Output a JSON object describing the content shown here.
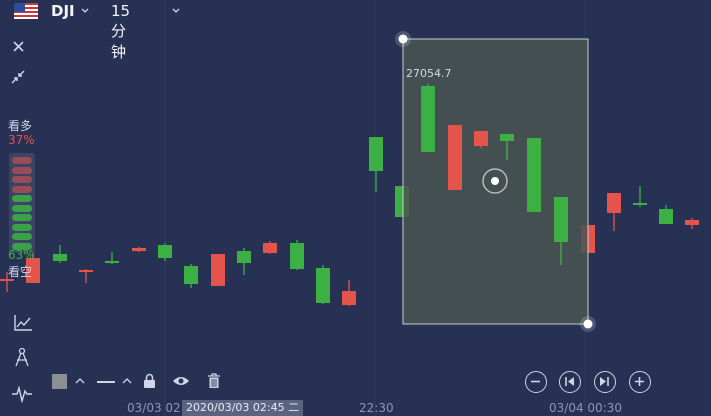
{
  "header": {
    "symbol": "DJI",
    "period": "15分钟"
  },
  "sentiment": {
    "bull_label": "看多",
    "bull_pct": "37%",
    "bear_pct": "63%",
    "bear_label": "看空",
    "bull_fraction": 0.37,
    "bull_color": "#e5544a",
    "bear_color": "#3cb043"
  },
  "selection": {
    "value_label": "27054.7"
  },
  "xaxis": {
    "tick1": "03/03 02",
    "tick2": "22:30",
    "tick3": "03/04 00:30",
    "cursor_label": "2020/03/03 02:45 二"
  },
  "colors": {
    "background": "#263154",
    "up": "#3cb043",
    "down": "#e5544a",
    "selection_fill": "#4a5551"
  },
  "icons": {
    "flag": "us-flag-icon",
    "close": "close-icon",
    "collapse": "collapse-icon",
    "indicator": "indicator-icon",
    "draw": "compass-icon",
    "wave": "waveform-icon",
    "lock": "lock-icon",
    "eye": "eye-icon",
    "trash": "trash-icon"
  },
  "chart_data": {
    "type": "candlestick",
    "candles": [
      {
        "t": 0,
        "o": 0.47,
        "h": 0.455,
        "l": 0.48,
        "c": 0.47,
        "dir": "down"
      },
      {
        "t": 1,
        "o": 0.44,
        "h": 0.425,
        "l": 0.448,
        "c": 0.44,
        "dir": "down"
      },
      {
        "t": 2,
        "o": 0.432,
        "h": 0.418,
        "l": 0.445,
        "c": 0.448,
        "dir": "up"
      },
      {
        "t": 3,
        "o": 0.475,
        "h": 0.47,
        "l": 0.495,
        "c": 0.475,
        "dir": "down"
      },
      {
        "t": 4,
        "o": 0.437,
        "h": 0.425,
        "l": 0.445,
        "c": 0.437,
        "dir": "up"
      },
      {
        "t": 5,
        "o": 0.424,
        "h": 0.42,
        "l": 0.427,
        "c": 0.424,
        "dir": "down"
      },
      {
        "t": 6,
        "o": 0.432,
        "h": 0.42,
        "l": 0.445,
        "c": 0.415,
        "dir": "up"
      },
      {
        "t": 7,
        "o": 0.46,
        "h": 0.455,
        "l": 0.48,
        "c": 0.495,
        "dir": "up"
      },
      {
        "t": 8,
        "o": 0.43,
        "h": 0.425,
        "l": 0.495,
        "c": 0.495,
        "dir": "down"
      },
      {
        "t": 9,
        "o": 0.45,
        "h": 0.42,
        "l": 0.475,
        "c": 0.43,
        "dir": "up"
      }
    ]
  }
}
